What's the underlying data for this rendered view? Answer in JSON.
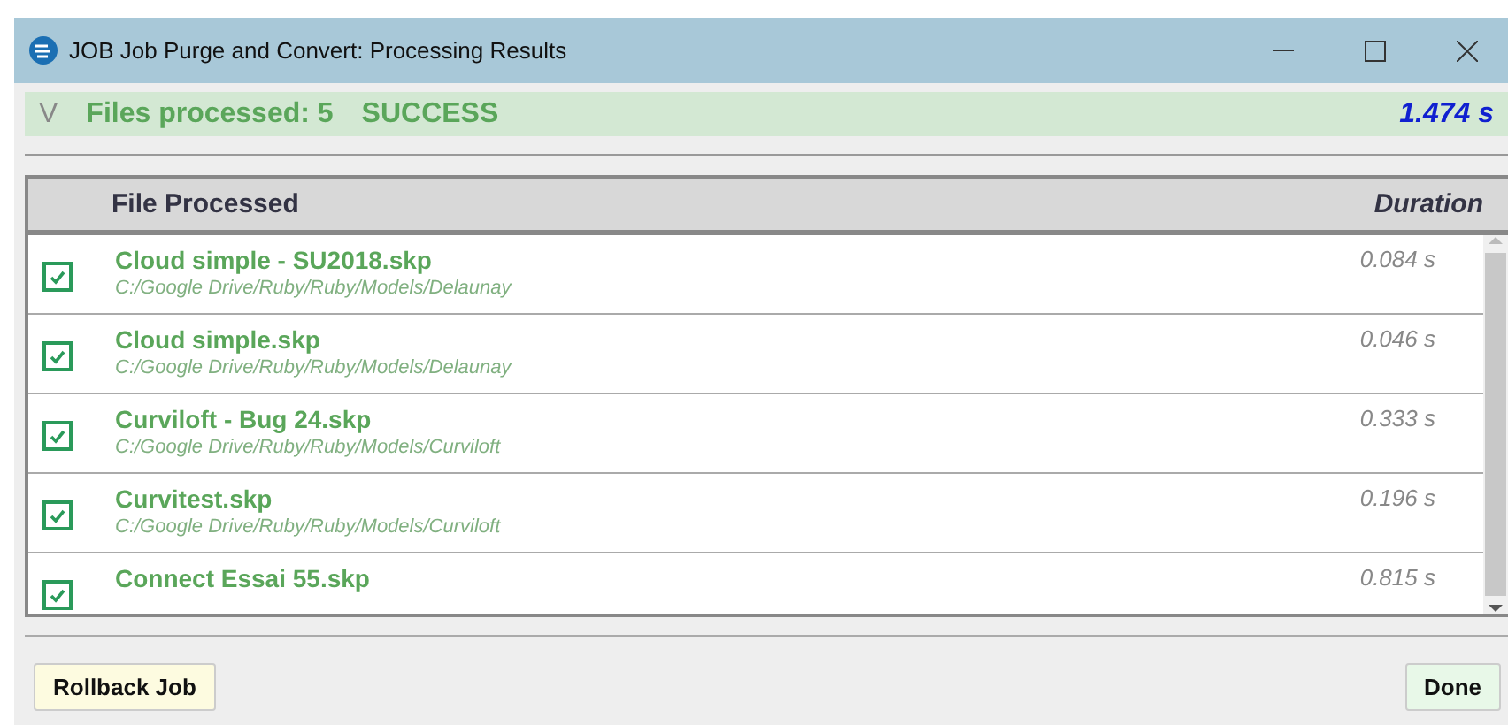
{
  "window": {
    "title": "JOB Job Purge and Convert: Processing Results"
  },
  "summary": {
    "toggle": "V",
    "expanded": true,
    "label": "Files processed: 5",
    "status": "SUCCESS",
    "duration": "1.474 s"
  },
  "table": {
    "columns": [
      "File Processed",
      "Duration"
    ],
    "rows": [
      {
        "checked": true,
        "name": "Cloud simple - SU2018.skp",
        "path": "C:/Google Drive/Ruby/Ruby/Models/Delaunay",
        "duration": "0.084 s"
      },
      {
        "checked": true,
        "name": "Cloud simple.skp",
        "path": "C:/Google Drive/Ruby/Ruby/Models/Delaunay",
        "duration": "0.046 s"
      },
      {
        "checked": true,
        "name": "Curviloft - Bug 24.skp",
        "path": "C:/Google Drive/Ruby/Ruby/Models/Curviloft",
        "duration": "0.333 s"
      },
      {
        "checked": true,
        "name": "Curvitest.skp",
        "path": "C:/Google Drive/Ruby/Ruby/Models/Curviloft",
        "duration": "0.196 s"
      },
      {
        "checked": true,
        "name": "Connect Essai 55.skp",
        "duration": "0.815 s"
      }
    ]
  },
  "buttons": {
    "left": "Rollback Job",
    "right": "Done"
  }
}
